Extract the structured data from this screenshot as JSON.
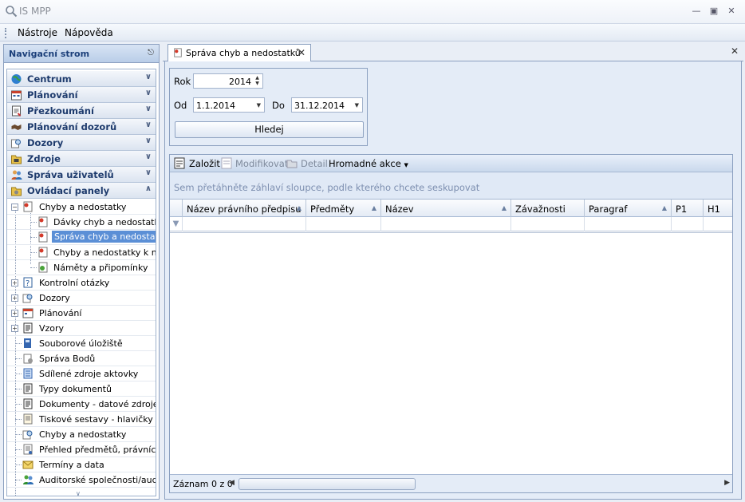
{
  "window": {
    "title": "IS MPP"
  },
  "menu": [
    "Nástroje",
    "Nápověda"
  ],
  "nav": {
    "title": "Navigační strom",
    "groups": [
      "Centrum",
      "Plánování",
      "Přezkoumání",
      "Plánování dozorů",
      "Dozory",
      "Zdroje",
      "Správa uživatelů",
      "Ovládací panely"
    ],
    "tree": [
      "Chyby a nedostatky",
      "Dávky chyb a nedostatků",
      "Správa chyb a nedostatků",
      "Chyby a nedostatky k n...",
      "Náměty a připomínky",
      "Kontrolní otázky",
      "Dozory",
      "Plánování",
      "Vzory",
      "Souborové úložiště",
      "Správa Bodů",
      "Sdílené zdroje aktovky",
      "Typy dokumentů",
      "Dokumenty - datové zdroje",
      "Tiskové sestavy - hlavičky a...",
      "Chyby a nedostatky",
      "Přehled předmětů, právních...",
      "Termíny a data",
      "Auditorské společnosti/audi..."
    ]
  },
  "tab": {
    "label": "Správa chyb a nedostatků"
  },
  "filter": {
    "rok_label": "Rok",
    "rok_value": "2014",
    "od_label": "Od",
    "od_value": "1.1.2014",
    "do_label": "Do",
    "do_value": "31.12.2014",
    "search_label": "Hledej"
  },
  "toolbar": {
    "zalozit": "Založit",
    "modifikovat": "Modifikovat",
    "detail": "Detail",
    "hromadne": "Hromadné akce"
  },
  "grid": {
    "group_hint": "Sem přetáhněte záhlaví sloupce, podle kterého chcete seskupovat",
    "columns": [
      "Název právního předpisu",
      "Předměty",
      "Název",
      "Závažnosti",
      "Paragraf",
      "P1",
      "H1"
    ],
    "status": "Záznam 0 z 0"
  }
}
